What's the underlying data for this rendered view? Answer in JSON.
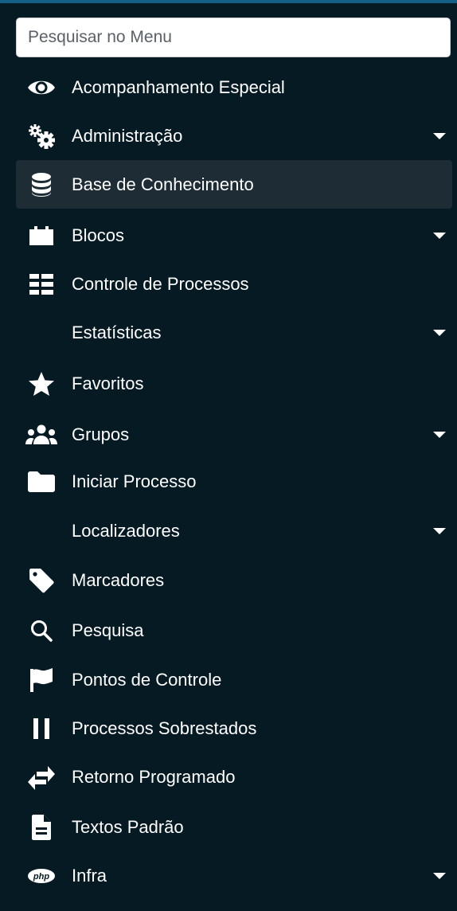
{
  "search": {
    "placeholder": "Pesquisar no Menu"
  },
  "colors": {
    "background": "#061a24",
    "active_item": "#1d2c35",
    "text": "#ffffff",
    "accent_line": "#155f86"
  },
  "menu": {
    "items": [
      {
        "label": "Acompanhamento Especial",
        "icon": "eye-icon",
        "has_submenu": false
      },
      {
        "label": "Administração",
        "icon": "gears-icon",
        "has_submenu": true
      },
      {
        "label": "Base de Conhecimento",
        "icon": "database-icon",
        "has_submenu": false,
        "active": true
      },
      {
        "label": "Blocos",
        "icon": "blocks-icon",
        "has_submenu": true
      },
      {
        "label": "Controle de Processos",
        "icon": "list-icon",
        "has_submenu": false
      },
      {
        "label": "Estatísticas",
        "icon": "",
        "has_submenu": true
      },
      {
        "label": "Favoritos",
        "icon": "star-icon",
        "has_submenu": false
      },
      {
        "label": "Grupos",
        "icon": "users-icon",
        "has_submenu": true
      },
      {
        "label": "Iniciar Processo",
        "icon": "folder-icon",
        "has_submenu": false
      },
      {
        "label": "Localizadores",
        "icon": "",
        "has_submenu": true
      },
      {
        "label": "Marcadores",
        "icon": "tag-icon",
        "has_submenu": false
      },
      {
        "label": "Pesquisa",
        "icon": "search-icon",
        "has_submenu": false
      },
      {
        "label": "Pontos de Controle",
        "icon": "flag-icon",
        "has_submenu": false
      },
      {
        "label": "Processos Sobrestados",
        "icon": "pause-icon",
        "has_submenu": false
      },
      {
        "label": "Retorno Programado",
        "icon": "exchange-icon",
        "has_submenu": false
      },
      {
        "label": "Textos Padrão",
        "icon": "document-icon",
        "has_submenu": false
      },
      {
        "label": "Infra",
        "icon": "php-icon",
        "has_submenu": true
      }
    ]
  }
}
